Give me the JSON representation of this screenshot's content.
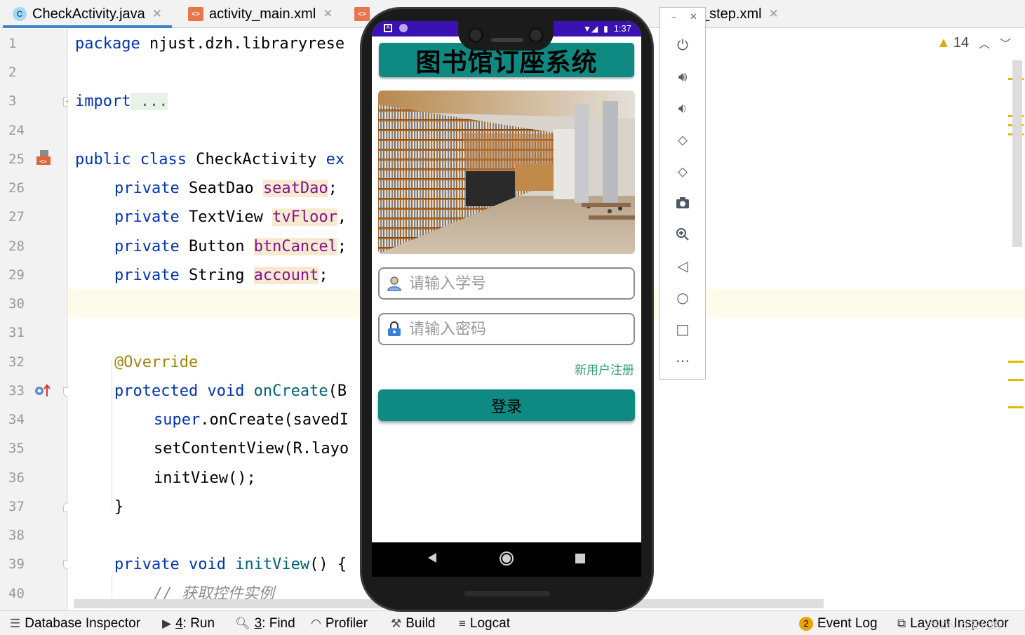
{
  "tabs": [
    {
      "label": "CheckActivity.java",
      "icon": "c"
    },
    {
      "label": "activity_main.xml",
      "icon": "<>"
    },
    {
      "label": "",
      "icon": "<>"
    },
    {
      "label": "_step.xml",
      "icon": "<>"
    }
  ],
  "editor": {
    "line_numbers": [
      "1",
      "2",
      "3",
      "24",
      "25",
      "26",
      "27",
      "28",
      "29",
      "30",
      "31",
      "32",
      "33",
      "34",
      "35",
      "36",
      "37",
      "38",
      "39",
      "40"
    ],
    "code": {
      "l1_kw": "package",
      "l1_rest": " njust.dzh.libraryrese",
      "l3_kw": "import",
      "l3_fold": " ...",
      "l25_kw": "public class",
      "l25_name": " CheckActivity ",
      "l25_ext": "ex",
      "l26_kw": "private",
      "l26_type": " SeatDao ",
      "l26_field": "seatDao",
      "l26_end": ";",
      "l27_kw": "private",
      "l27_type": " TextView ",
      "l27_field": "tvFloor",
      "l27_end": ",",
      "l28_kw": "private",
      "l28_type": " Button ",
      "l28_field": "btnCancel",
      "l28_end": ";",
      "l29_kw": "private",
      "l29_type": " String ",
      "l29_field": "account",
      "l29_end": ";",
      "l32_ann": "@Override",
      "l33_kw": "protected void",
      "l33_m": " onCreate",
      "l33_rest": "(B",
      "l34_kw": "super",
      "l34_rest": ".onCreate(savedI",
      "l35": "setContentView(R.layo",
      "l36": "initView();",
      "l37": "}",
      "l39_kw": "private void",
      "l39_m": " initView",
      "l39_rest": "() {",
      "l40_com": "// 获取控件实例"
    },
    "warnings_count": "14"
  },
  "bottom_bar": {
    "database_inspector": "Database Inspector",
    "run_num": "4",
    "run": ": Run",
    "find_num": "3",
    "find": ": Find",
    "profiler": "Profiler",
    "build": "Build",
    "logcat": "Logcat",
    "event_badge": "2",
    "event_log": "Event Log",
    "layout_inspector": "Layout Inspector"
  },
  "watermark": "CSDN @五代的",
  "emulator_tools": [
    "power-icon",
    "volume-up-icon",
    "volume-down-icon",
    "rotate-left-icon",
    "rotate-right-icon",
    "camera-icon",
    "zoom-icon",
    "back-icon",
    "home-icon",
    "overview-icon",
    "more-icon"
  ],
  "phone": {
    "status_time": "1:37",
    "app_title": "图书馆订座系统",
    "student_id_placeholder": "请输入学号",
    "password_placeholder": "请输入密码",
    "register_link": "新用户注册",
    "login_button": "登录"
  },
  "colors": {
    "accent_teal": "#0e8a82",
    "status_bar": "#3a11b3",
    "ide_tab_underline": "#4083c9",
    "keyword": "#0033b3",
    "field": "#871094"
  }
}
